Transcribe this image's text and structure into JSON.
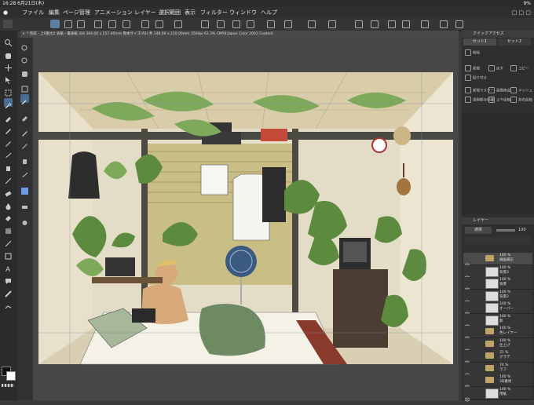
{
  "status": {
    "time": "16:28",
    "date": "6月21日(木)",
    "battery": "9%"
  },
  "menu": [
    "ファイル",
    "編集",
    "ページ管理",
    "アニメーション",
    "レイヤー",
    "選択範囲",
    "表示",
    "フィルター",
    "ウィンドウ",
    "ヘルプ"
  ],
  "doc_tab": {
    "title": "* 完成 - 上0箇大2 表紙・裏表紙 (B4 364.00 x 257.00mm 製本サイズ(A5) 判 148.00 x 210.00mm 350dpi 62.3% CMYK:Japan Color 2001 Coated)"
  },
  "right_panel": {
    "quick_access": "クイックアクセス",
    "set_tabs": [
      "セット1",
      "セット2"
    ],
    "quick_buttons": [
      "削除",
      "新規",
      "戻す",
      "取り消し",
      "コピー",
      "貼り付け",
      "新規ラスター",
      "画像統合",
      "メッシュ",
      "上下反転",
      "左右反転",
      "透明部分保護"
    ],
    "layer_title": "レイヤー",
    "blend_mode": "通常",
    "opacity": "100"
  },
  "layers": [
    {
      "name": "100 %\n線画補正",
      "type": "folder",
      "selected": true
    },
    {
      "name": "100 %\n背景3",
      "type": "raster"
    },
    {
      "name": "100 %\n背景",
      "type": "raster"
    },
    {
      "name": "100 %\n背景2",
      "type": "raster"
    },
    {
      "name": "100 %\nオーバー",
      "type": "raster"
    },
    {
      "name": "100 %\n影",
      "type": "raster"
    },
    {
      "name": "100 %\n色レイヤー",
      "type": "folder"
    },
    {
      "name": "100 %\n仕上げ",
      "type": "folder"
    },
    {
      "name": "31 %\nグラデ",
      "type": "folder"
    },
    {
      "name": "74 %\nラフ",
      "type": "folder"
    },
    {
      "name": "100 %\n3D素材",
      "type": "folder"
    },
    {
      "name": "100 %\n用紙",
      "type": "raster"
    }
  ]
}
